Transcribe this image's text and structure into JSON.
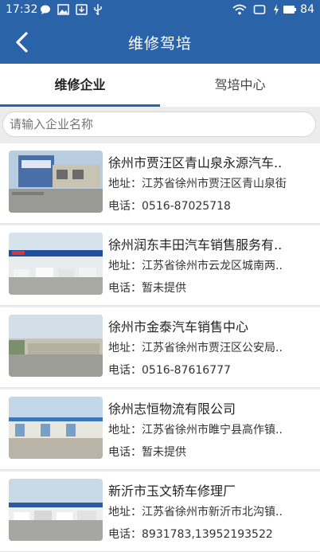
{
  "status_bar": {
    "time": "17:32",
    "battery": "84"
  },
  "header": {
    "title": "维修驾培"
  },
  "tabs": [
    {
      "label": "维修企业"
    },
    {
      "label": "驾培中心"
    }
  ],
  "search": {
    "placeholder": "请输入企业名称"
  },
  "listings": [
    {
      "name": "徐州市贾汪区青山泉永源汽车..",
      "address": "地址：江苏省徐州市贾汪区青山泉街",
      "phone": "电话：0516-87025718"
    },
    {
      "name": "徐州润东丰田汽车销售服务有..",
      "address": "地址：江苏省徐州市云龙区城南两..",
      "phone": "电话：暂未提供"
    },
    {
      "name": "徐州市金泰汽车销售中心",
      "address": "地址：江苏省徐州市贾汪区公安局..",
      "phone": "电话：0516-87616777"
    },
    {
      "name": "徐州志恒物流有限公司",
      "address": "地址：江苏省徐州市睢宁县高作镇..",
      "phone": "电话：暂未提供"
    },
    {
      "name": "新沂市玉文轿车修理厂",
      "address": "地址：江苏省徐州市新沂市北沟镇..",
      "phone": "电话：8931783,13952193522"
    }
  ],
  "colors": {
    "primary": "#2b63a8"
  }
}
